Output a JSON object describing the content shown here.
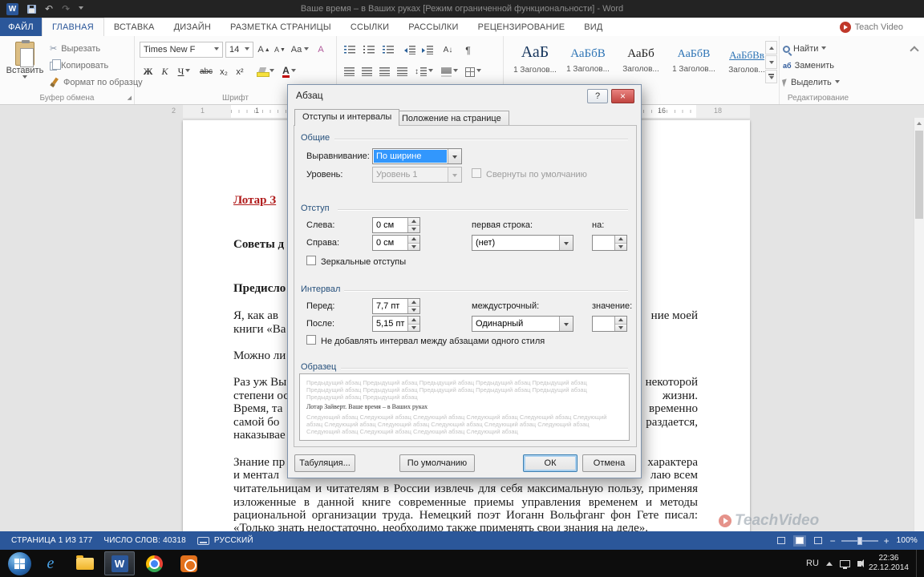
{
  "title_bar": {
    "title": "Ваше время – в Ваших руках [Режим ограниченной функциональности] - Word",
    "icons": {
      "word_logo": "W",
      "undo": "↶",
      "redo": "↷"
    }
  },
  "tab_row": {
    "file_tab": "ФАЙЛ",
    "tabs": [
      "ГЛАВНАЯ",
      "ВСТАВКА",
      "ДИЗАЙН",
      "РАЗМЕТКА СТРАНИЦЫ",
      "ССЫЛКИ",
      "РАССЫЛКИ",
      "РЕЦЕНЗИРОВАНИЕ",
      "ВИД"
    ],
    "teach_video": "Teach Video"
  },
  "ribbon": {
    "clipboard": {
      "paste": "Вставить",
      "cut": "Вырезать",
      "copy": "Копировать",
      "format_painter": "Формат по образцу",
      "group_label": "Буфер обмена"
    },
    "font": {
      "family": "Times New F",
      "size": "14",
      "bold": "Ж",
      "italic": "К",
      "underline": "Ч",
      "strikethrough": "abc",
      "subscript": "x₂",
      "superscript": "x²",
      "grow": "А",
      "shrink": "А",
      "change_case": "Аа",
      "color_letter": "А",
      "group_label": "Шрифт"
    },
    "paragraph": {
      "sort_letter": "А↓",
      "pilcrow": "¶"
    },
    "styles": {
      "items": [
        {
          "preview": "АаБ",
          "label": "1 Заголов..."
        },
        {
          "preview": "АаБбВ",
          "label": "1 Заголов..."
        },
        {
          "preview": "АаБб",
          "label": "Заголов..."
        },
        {
          "preview": "АаБбВ",
          "label": "1 Заголов..."
        },
        {
          "preview": "АаБбВв",
          "label": "Заголов..."
        }
      ]
    },
    "editing": {
      "find": "Найти",
      "replace": "Заменить",
      "select": "Выделить",
      "replace_icon": "аб",
      "group_label": "Редактирование"
    }
  },
  "ruler": {
    "marks": [
      "2",
      "1",
      "1",
      "16",
      "18"
    ]
  },
  "document": {
    "fragments": [
      "Лотар З",
      "Советы д",
      "Предисло",
      "Я, как ав",
      "ние моей",
      "книги «Ва",
      "Можно ли",
      "Раз уж Вы",
      "некоторой",
      "степени ос",
      "жизни.",
      "Время, та",
      "временно",
      "самой бо",
      "раздается,",
      "наказывае",
      "Знание пр",
      "характера",
      "и ментал",
      "лаю всем",
      "читательницам и читателям в России извлечь для себя максимальную пользу, применяя",
      "изложенные в данной книге современные приемы управления временем и методы",
      "рациональной организации труда. Немецкий поэт Иоганн Вольфганг фон Гете писал:",
      "«Только знать недостаточно, необходимо также применять свои знания на деле»."
    ]
  },
  "dialog": {
    "title": "Абзац",
    "help": "?",
    "close": "×",
    "tab_indents": "Отступы и интервалы",
    "tab_position": "Положение на странице",
    "general": {
      "label": "Общие",
      "alignment_label": "Выравнивание:",
      "alignment_value": "По ширине",
      "outline_label": "Уровень:",
      "outline_value": "Уровень 1",
      "collapsed_label": "Свернуты по умолчанию"
    },
    "indentation": {
      "label": "Отступ",
      "left_label": "Слева:",
      "left_value": "0 см",
      "right_label": "Справа:",
      "right_value": "0 см",
      "special_label": "первая строка:",
      "special_value": "(нет)",
      "by_label": "на:",
      "by_value": "",
      "mirror_label": "Зеркальные отступы"
    },
    "spacing": {
      "label": "Интервал",
      "before_label": "Перед:",
      "before_value": "7,7 пт",
      "after_label": "После:",
      "after_value": "5,15 пт",
      "line_label": "междустрочный:",
      "line_value": "Одинарный",
      "at_label": "значение:",
      "at_value": "",
      "same_style_label": "Не добавлять интервал между абзацами одного стиля"
    },
    "preview": {
      "label": "Образец",
      "before": "Предыдущий абзац Предыдущий абзац Предыдущий абзац Предыдущий абзац Предыдущий абзац Предыдущий абзац Предыдущий абзац Предыдущий абзац Предыдущий абзац Предыдущий абзац Предыдущий абзац Предыдущий абзац",
      "current": "Лотар Зайверт. Ваше время – в Ваших руках",
      "after": "Следующий абзац Следующий абзац Следующий абзац Следующий абзац Следующий абзац Следующий абзац Следующий абзац Следующий абзац Следующий абзац Следующий абзац Следующий абзац Следующий абзац Следующий абзац Следующий абзац Следующий абзац"
    },
    "buttons": {
      "tabs": "Табуляция...",
      "set_default": "По умолчанию",
      "ok": "ОК",
      "cancel": "Отмена"
    }
  },
  "status_bar": {
    "page": "СТРАНИЦА 1 ИЗ 177",
    "words": "ЧИСЛО СЛОВ: 40318",
    "language": "РУССКИЙ",
    "zoom_out": "−",
    "zoom_in": "+",
    "zoom_level": "100%"
  },
  "watermark": {
    "text": "TeachVideo"
  },
  "taskbar": {
    "language": "RU",
    "time": "22:36",
    "date": "22.12.2014"
  }
}
